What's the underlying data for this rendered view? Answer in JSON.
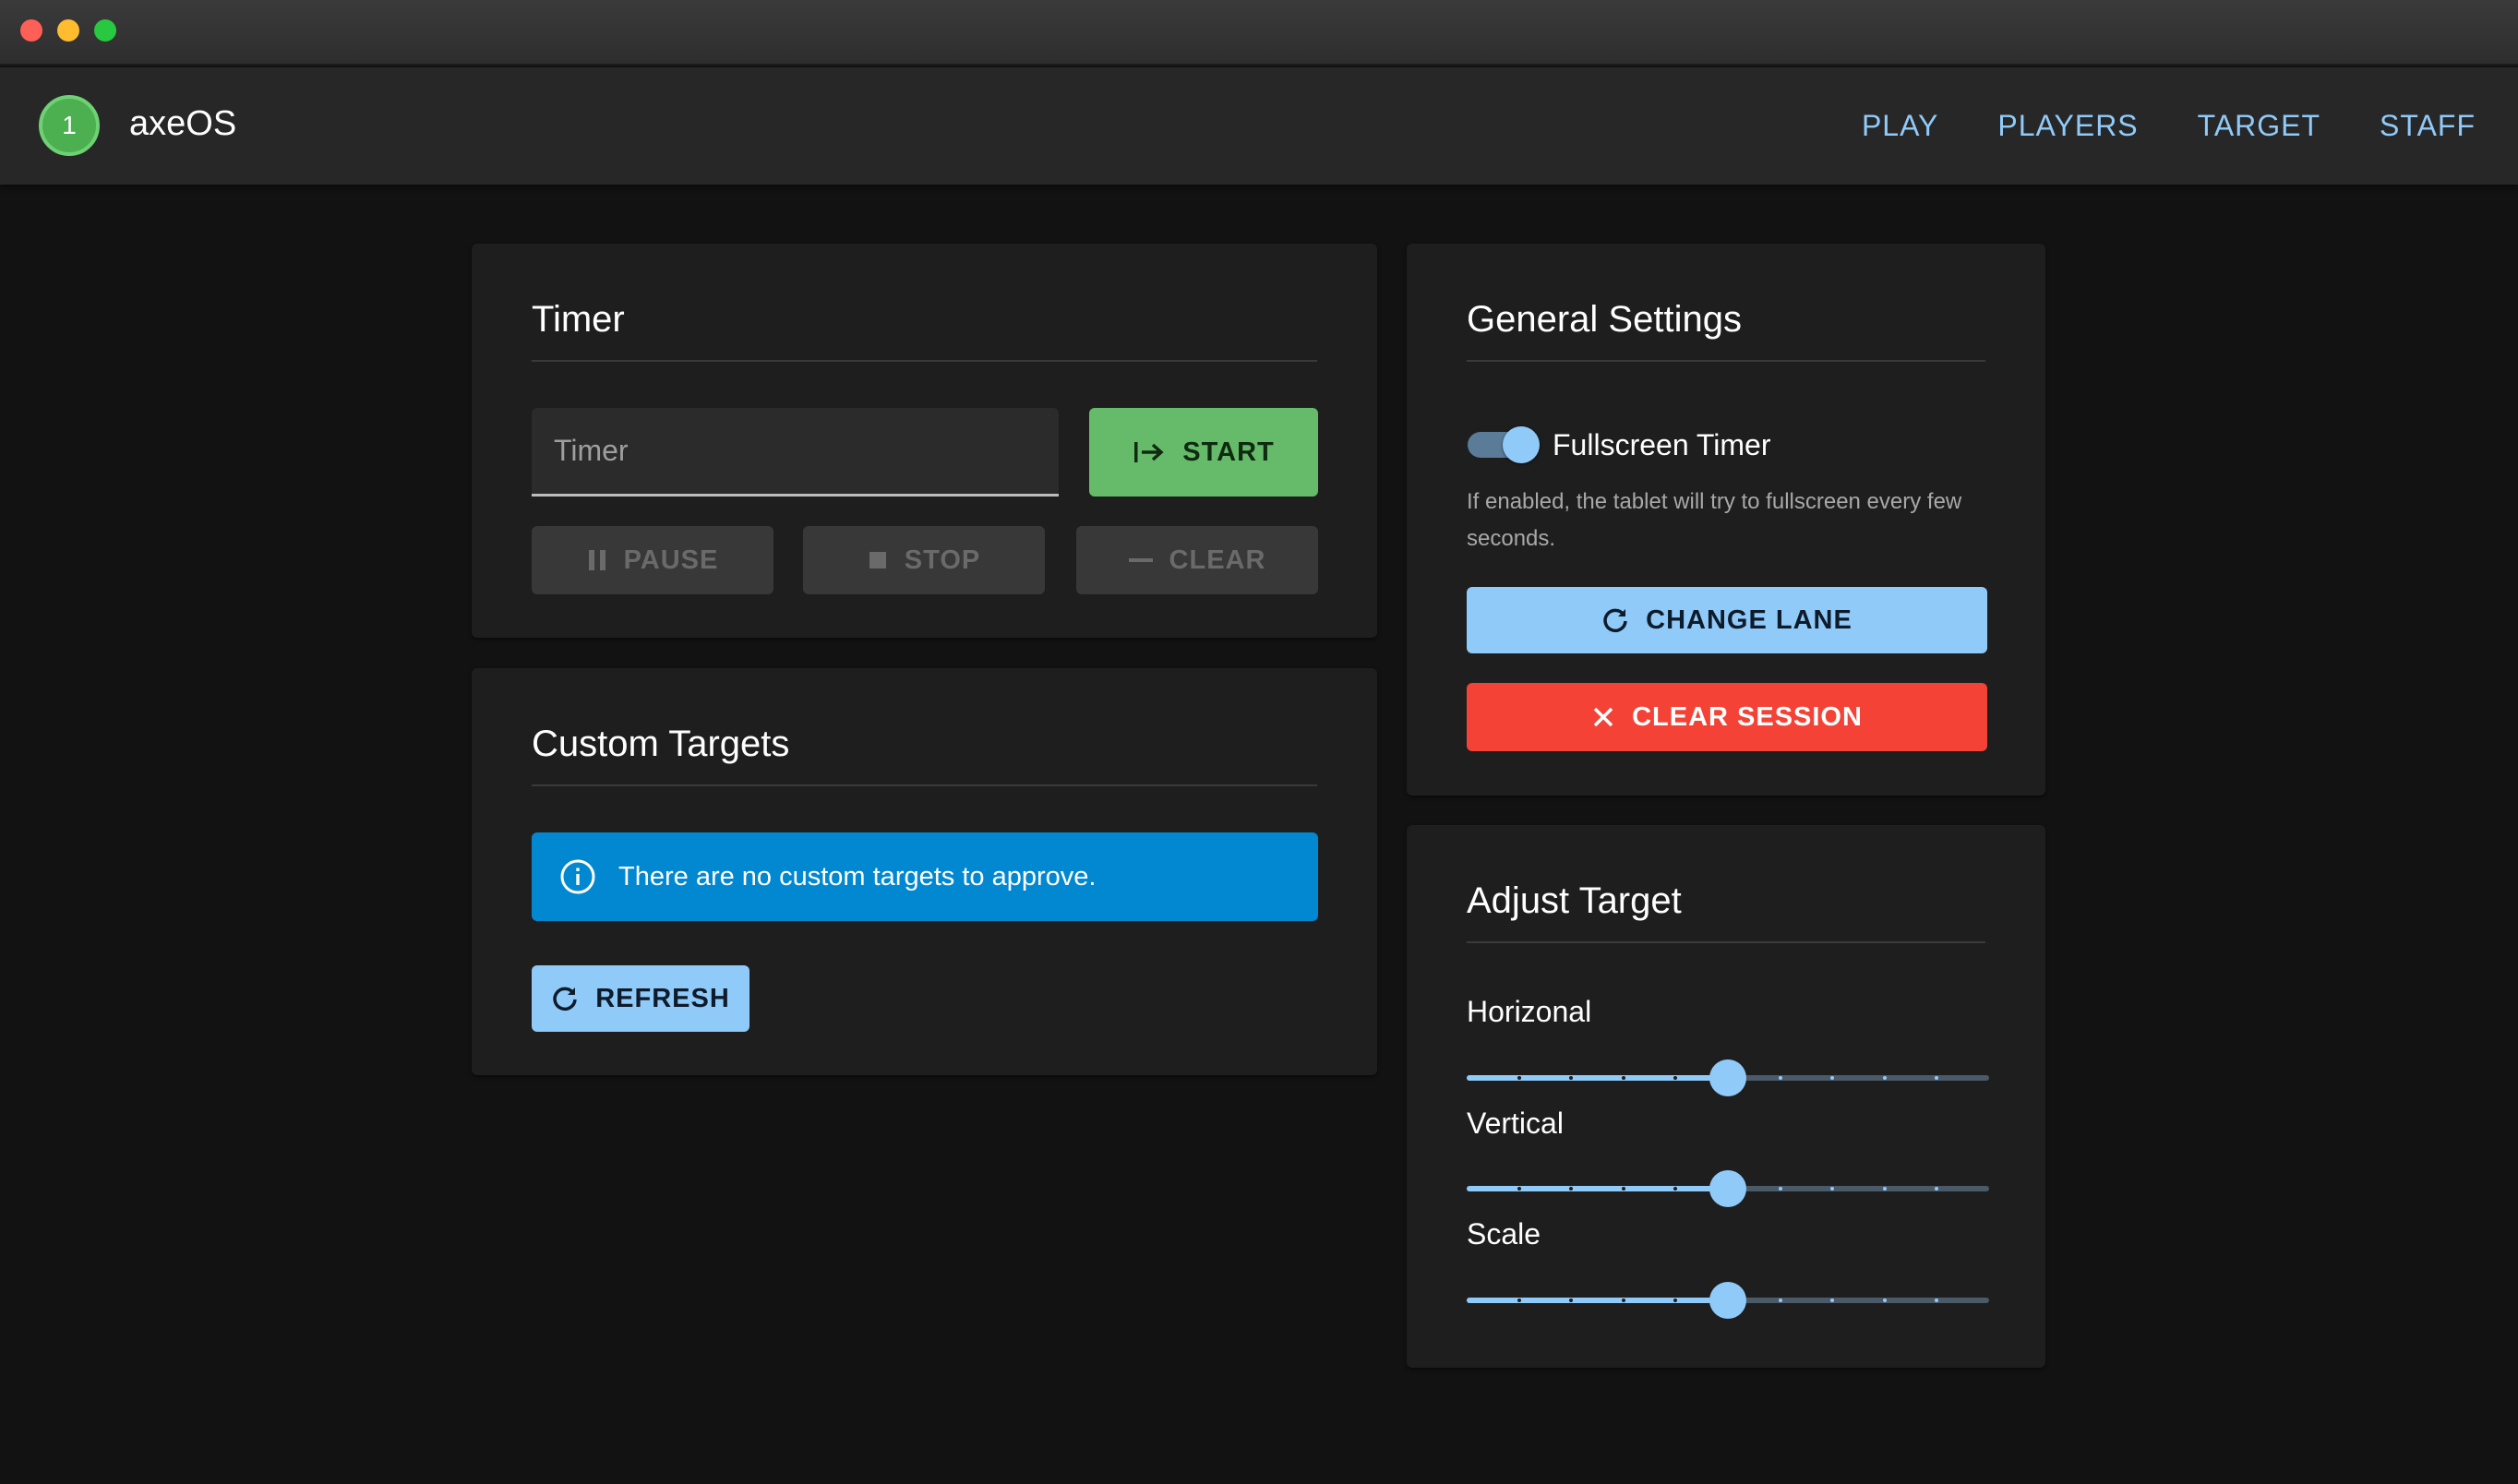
{
  "app": {
    "lane_number": "1",
    "title": "axeOS",
    "nav": [
      "PLAY",
      "PLAYERS",
      "TARGET",
      "STAFF"
    ]
  },
  "timer": {
    "title": "Timer",
    "input_placeholder": "Timer",
    "start_label": "START",
    "pause_label": "PAUSE",
    "stop_label": "STOP",
    "clear_label": "CLEAR"
  },
  "custom_targets": {
    "title": "Custom Targets",
    "alert_text": "There are no custom targets to approve.",
    "refresh_label": "REFRESH"
  },
  "general_settings": {
    "title": "General Settings",
    "fullscreen_toggle_label": "Fullscreen Timer",
    "fullscreen_enabled": true,
    "hint": "If enabled, the tablet will try to fullscreen every few seconds.",
    "change_lane_label": "CHANGE LANE",
    "clear_session_label": "CLEAR SESSION"
  },
  "adjust_target": {
    "title": "Adjust Target",
    "sliders": [
      {
        "label": "Horizonal",
        "value": 0.5,
        "steps": 10
      },
      {
        "label": "Vertical",
        "value": 0.5,
        "steps": 10
      },
      {
        "label": "Scale",
        "value": 0.5,
        "steps": 10
      }
    ]
  },
  "colors": {
    "accent": "#90caf9",
    "start": "#66bb6a",
    "danger": "#f44336",
    "info": "#0288d1",
    "lane_badge": "#4caf50"
  },
  "icons": {
    "start": "arrow-right-to-bar-icon",
    "pause": "pause-icon",
    "stop": "stop-icon",
    "clear": "minus-icon",
    "info": "info-circle-icon",
    "refresh": "refresh-icon",
    "change_lane": "refresh-icon",
    "clear_session": "close-icon"
  }
}
